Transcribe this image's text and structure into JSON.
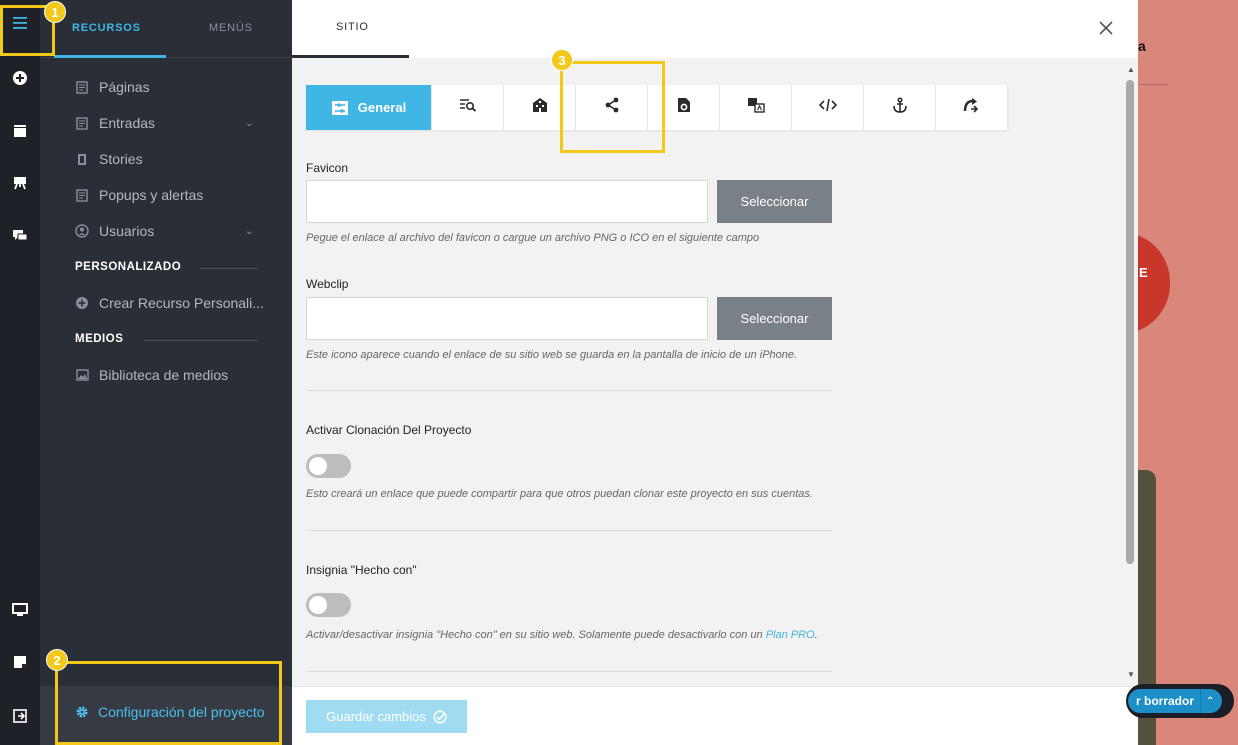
{
  "rail": {
    "icons": [
      "hamburger-menu-icon",
      "add-circle-icon",
      "box-icon",
      "easel-icon",
      "chat-icon",
      "monitor-icon",
      "note-icon",
      "logout-icon"
    ]
  },
  "sidebar": {
    "tabs": [
      {
        "label": "RECURSOS",
        "active": true
      },
      {
        "label": "MENÚS",
        "active": false
      }
    ],
    "items": [
      {
        "label": "Páginas",
        "icon": "page-icon",
        "caret": false
      },
      {
        "label": "Entradas",
        "icon": "page-icon",
        "caret": true
      },
      {
        "label": "Stories",
        "icon": "story-icon",
        "caret": false
      },
      {
        "label": "Popups y alertas",
        "icon": "page-icon",
        "caret": false
      },
      {
        "label": "Usuarios",
        "icon": "user-icon",
        "caret": true
      }
    ],
    "section_custom": "PERSONALIZADO",
    "custom_item": {
      "label": "Crear Recurso Personali...",
      "icon": "add-circle-icon"
    },
    "section_media": "MEDIOS",
    "media_item": {
      "label": "Biblioteca de medios",
      "icon": "image-icon"
    },
    "footer_item": {
      "label": "Configuración del proyecto",
      "icon": "gear-icon",
      "color": "#4cc0ee"
    }
  },
  "panel": {
    "tab": "SITIO",
    "toolbar": {
      "active_label": "General",
      "icons": [
        "general-settings-icon",
        "seo-search-icon",
        "building-icon",
        "share-icon",
        "file-gear-icon",
        "translate-icon",
        "code-icon",
        "anchor-icon",
        "redirect-icon"
      ]
    },
    "favicon": {
      "label": "Favicon",
      "value": "",
      "button": "Seleccionar",
      "help": "Pegue el enlace al archivo del favicon o cargue un archivo PNG o ICO en el siguiente campo"
    },
    "webclip": {
      "label": "Webclip",
      "value": "",
      "button": "Seleccionar",
      "help": "Este icono aparece cuando el enlace de su sitio web se guarda en la pantalla de inicio de un iPhone."
    },
    "cloning": {
      "label": "Activar Clonación Del Proyecto",
      "enabled": false,
      "help": "Esto creará un enlace que puede compartir para que otros puedan clonar este proyecto en sus cuentas."
    },
    "badge": {
      "label": "Insignia \"Hecho con\"",
      "enabled": false,
      "help_prefix": "Activar/desactivar insignia \"Hecho con\" en su sitio web. Solamente puede desactivarlo con un ",
      "help_link": "Plan PRO",
      "help_suffix": "."
    },
    "save_button": "Guardar cambios"
  },
  "background": {
    "letter": "E",
    "mark": "a",
    "draft_label": "r borrador"
  },
  "callouts": [
    "1",
    "2",
    "3"
  ],
  "colors": {
    "accent": "#3fb6e3",
    "callout": "#f2c81a",
    "sidebar_bg": "#2a2e36",
    "rail_bg": "#1e2228"
  }
}
